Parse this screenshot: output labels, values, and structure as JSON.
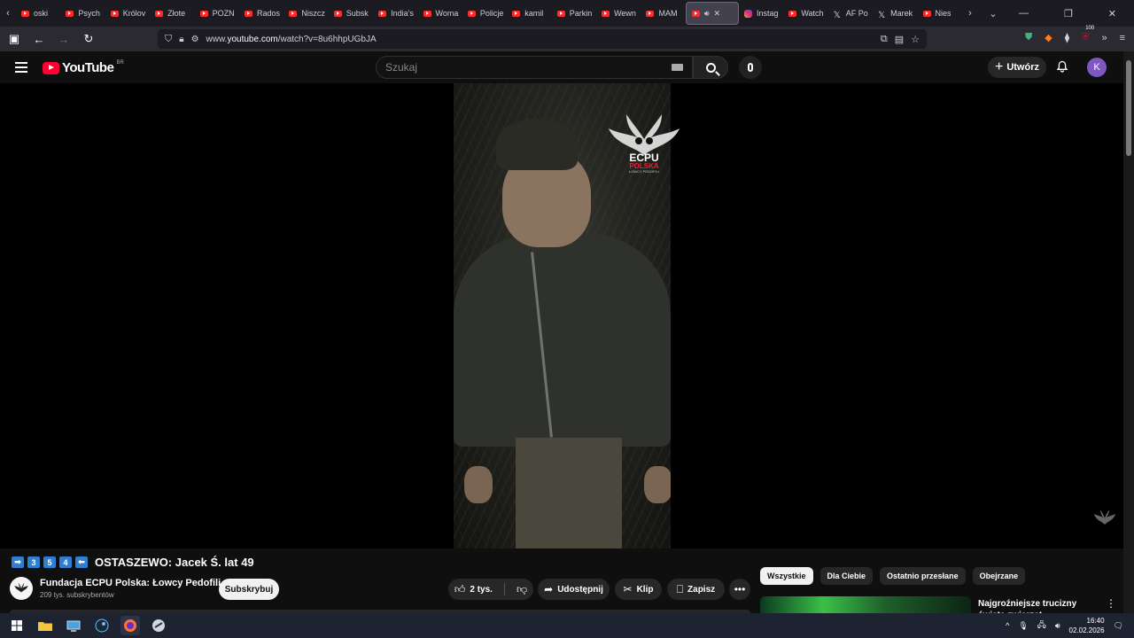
{
  "browser": {
    "tabs": [
      {
        "label": "oski"
      },
      {
        "label": "Psych"
      },
      {
        "label": "Królov"
      },
      {
        "label": "Złote"
      },
      {
        "label": "POZN"
      },
      {
        "label": "Rados"
      },
      {
        "label": "Niszcz"
      },
      {
        "label": "Subsk"
      },
      {
        "label": "India's"
      },
      {
        "label": "Woma"
      },
      {
        "label": "Policje"
      },
      {
        "label": "kamil"
      },
      {
        "label": "Parkin"
      },
      {
        "label": "Wewn"
      },
      {
        "label": "MAM"
      }
    ],
    "trailing_tabs": [
      {
        "label": "Instag",
        "icon": "instagram-icon"
      },
      {
        "label": "Watch",
        "icon": "youtube-icon"
      },
      {
        "label": "AF Po",
        "icon": "x-icon"
      },
      {
        "label": "Marek",
        "icon": "x-icon"
      },
      {
        "label": "Nies",
        "icon": "youtube-icon"
      }
    ],
    "url_prefix": "www.",
    "url_domain": "youtube.com",
    "url_path": "/watch?v=8u6hhpUGbJA",
    "badge_count": "100"
  },
  "youtube": {
    "logo_text": "YouTube",
    "country_code": "BR",
    "search_placeholder": "Szukaj",
    "create_label": "Utwórz",
    "avatar_letter": "K"
  },
  "watermark": {
    "line1": "ECPU",
    "line2": "POLSKA",
    "line3": "ŁOWCY PEDOFILI"
  },
  "video": {
    "title_badges": [
      "➡",
      "3",
      "5",
      "4",
      "⬅"
    ],
    "title": "OSTASZEWO: Jacek Ś. lat 49",
    "channel_name": "Fundacja ECPU Polska: Łowcy Pedofili",
    "subscribers": "209 tys. subskrybentów",
    "subscribe_label": "Subskrybuj",
    "likes": "2 tys.",
    "share_label": "Udostępnij",
    "clip_label": "Klip",
    "save_label": "Zapisz"
  },
  "chips": [
    "Wszystkie",
    "Dla Ciebie",
    "Ostatnio przesłane",
    "Obejrzane"
  ],
  "recommendation": {
    "title": "Najgroźniejsze trucizny świata zwierząt"
  },
  "taskbar": {
    "time": "16:40",
    "date": "02.02.2026"
  }
}
